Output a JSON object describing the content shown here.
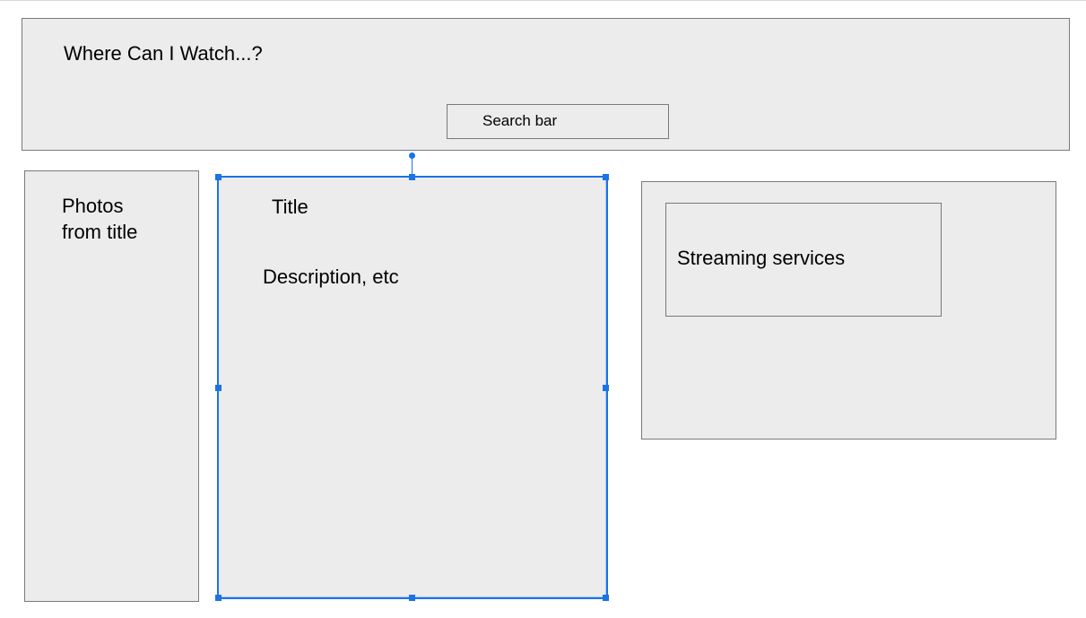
{
  "header": {
    "title": "Where Can I Watch...?",
    "search_label": "Search bar"
  },
  "left_panel": {
    "label": "Photos\nfrom title"
  },
  "center_panel": {
    "title": "Title",
    "description": "Description, etc"
  },
  "right_panel": {
    "services_label": "Streaming services"
  },
  "colors": {
    "box_fill": "#ececec",
    "box_border": "#7a7a7a",
    "selection": "#1a73e8"
  }
}
